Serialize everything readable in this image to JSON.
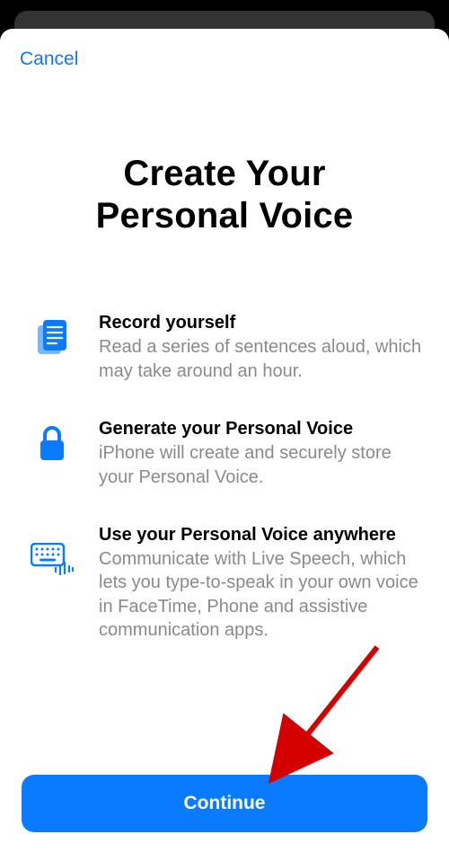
{
  "header": {
    "cancel_label": "Cancel"
  },
  "title_line1": "Create Your",
  "title_line2": "Personal Voice",
  "features": [
    {
      "title": "Record yourself",
      "subtitle": "Read a series of sentences aloud, which may take around an hour."
    },
    {
      "title": "Generate your Personal Voice",
      "subtitle": "iPhone will create and securely store your Personal Voice."
    },
    {
      "title": "Use your Personal Voice anywhere",
      "subtitle": "Communicate with Live Speech, which lets you type-to-speak in your own voice in FaceTime, Phone and assistive communication apps."
    }
  ],
  "continue_label": "Continue",
  "accent": "#0a7aff"
}
